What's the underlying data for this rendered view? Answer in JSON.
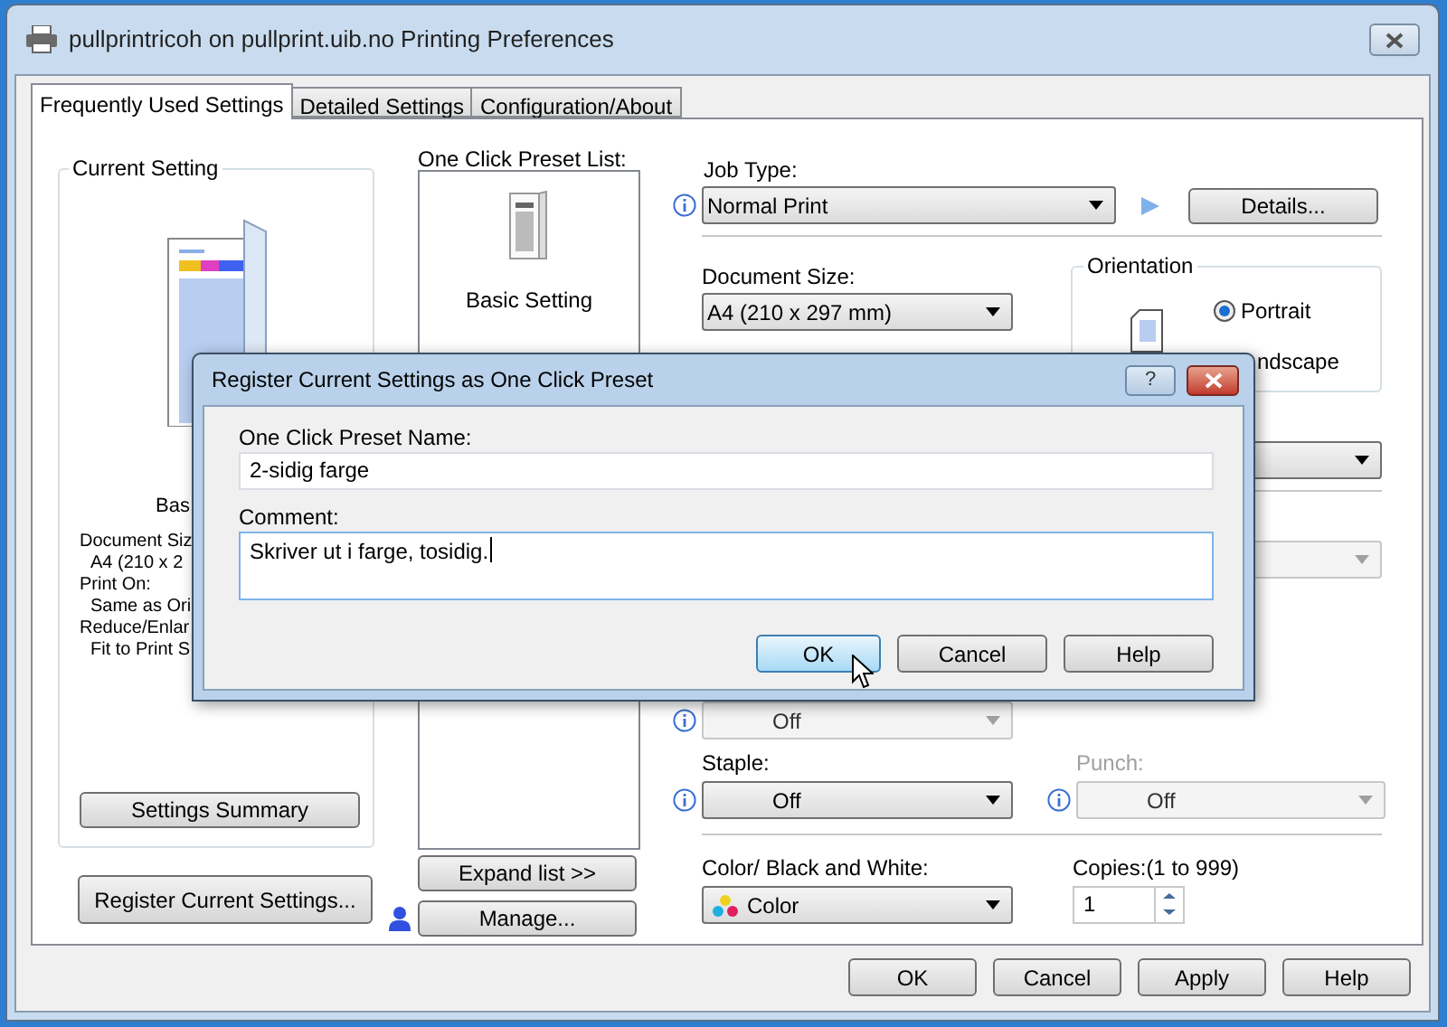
{
  "window": {
    "title": "pullprintricoh on pullprint.uib.no Printing Preferences"
  },
  "tabs": [
    {
      "label": "Frequently Used Settings",
      "selected": true
    },
    {
      "label": "Detailed Settings",
      "selected": false
    },
    {
      "label": "Configuration/About",
      "selected": false
    }
  ],
  "current_setting": {
    "title": "Current Setting",
    "preset_name": "Bas",
    "sections": [
      {
        "heading": "Document Siz",
        "value": "A4 (210 x 2"
      },
      {
        "heading": "Print On:",
        "value": "Same as Ori"
      },
      {
        "heading": "Reduce/Enlar",
        "value": "Fit to Print S"
      }
    ],
    "summary_button": "Settings Summary"
  },
  "register_button": "Register Current Settings...",
  "preset_list": {
    "label": "One Click Preset List:",
    "items": [
      {
        "name": "Basic Setting",
        "selected": false
      }
    ],
    "expand_button": "Expand list >>",
    "manage_button": "Manage..."
  },
  "job_type": {
    "label": "Job Type:",
    "value": "Normal Print",
    "details_button": "Details..."
  },
  "document_size": {
    "label": "Document Size:",
    "value": "A4 (210 x 297 mm)"
  },
  "orientation": {
    "title": "Orientation",
    "portrait": {
      "label": "Portrait",
      "selected": true
    },
    "landscape_label": "ndscape"
  },
  "covered_dropdowns": [
    {
      "disabled": false
    },
    {
      "disabled": true
    }
  ],
  "finishing": {
    "value": "Off",
    "disabled": true
  },
  "staple": {
    "label": "Staple:",
    "value": "Off",
    "disabled": false
  },
  "punch": {
    "label": "Punch:",
    "value": "Off",
    "disabled": true
  },
  "color_mode": {
    "label": "Color/ Black and White:",
    "value": "Color"
  },
  "copies": {
    "label": "Copies:(1 to 999)",
    "value": "1"
  },
  "buttons": [
    {
      "label": "OK"
    },
    {
      "label": "Cancel"
    },
    {
      "label": "Apply"
    },
    {
      "label": "Help"
    }
  ],
  "dialog": {
    "title": "Register Current Settings as One Click Preset",
    "help_glyph": "?",
    "name_label": "One Click Preset Name:",
    "name_value": "2-sidig farge",
    "comment_label": "Comment:",
    "comment_value": "Skriver ut i farge, tosidig.",
    "buttons": [
      {
        "label": "OK",
        "focused": true
      },
      {
        "label": "Cancel",
        "focused": false
      },
      {
        "label": "Help",
        "focused": false
      }
    ]
  }
}
